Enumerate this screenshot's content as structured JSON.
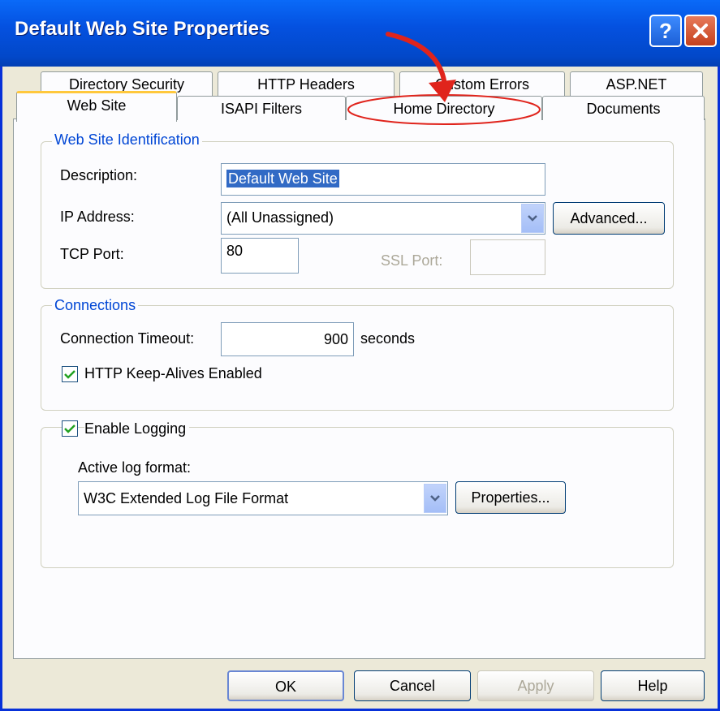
{
  "window": {
    "title": "Default Web Site Properties"
  },
  "tabs_back": [
    "Directory Security",
    "HTTP Headers",
    "Custom Errors",
    "ASP.NET"
  ],
  "tabs_front": [
    "Web Site",
    "ISAPI Filters",
    "Home Directory",
    "Documents"
  ],
  "active_tab": "Web Site",
  "identification": {
    "title": "Web Site Identification",
    "description_label": "Description:",
    "description_value": "Default Web Site",
    "ip_label": "IP Address:",
    "ip_value": "(All Unassigned)",
    "advanced_label": "Advanced...",
    "tcp_label": "TCP Port:",
    "tcp_value": "80",
    "ssl_label": "SSL Port:",
    "ssl_value": ""
  },
  "connections": {
    "title": "Connections",
    "timeout_label": "Connection Timeout:",
    "timeout_value": "900",
    "timeout_unit": "seconds",
    "keepalive_label": "HTTP Keep-Alives Enabled",
    "keepalive_checked": true
  },
  "logging": {
    "enable_label": "Enable Logging",
    "enable_checked": true,
    "format_label": "Active log format:",
    "format_value": "W3C Extended Log File Format",
    "properties_label": "Properties..."
  },
  "buttons": {
    "ok": "OK",
    "cancel": "Cancel",
    "apply": "Apply",
    "help": "Help"
  },
  "colors": {
    "titlebar": "#0451e0",
    "annotation": "#e0241c",
    "group_title": "#0046d5"
  }
}
